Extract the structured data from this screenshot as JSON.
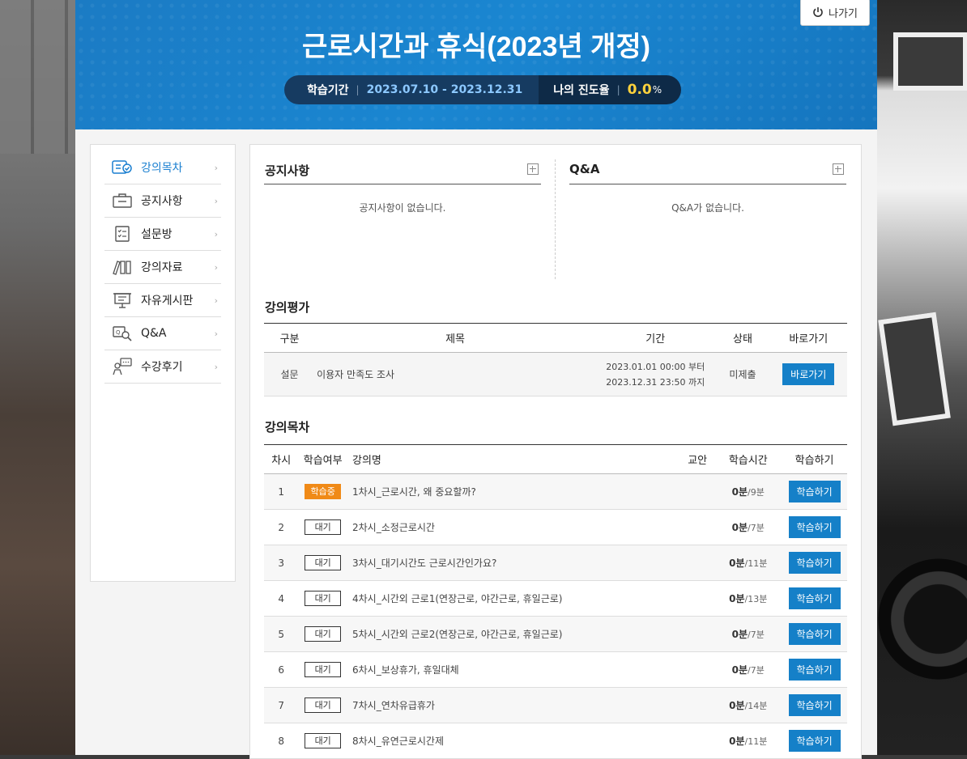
{
  "header": {
    "title": "근로시간과 휴식(2023년 개정)",
    "exit_label": "나가기",
    "period_label": "학습기간",
    "period_value": "2023.07.10 - 2023.12.31",
    "progress_label": "나의 진도율",
    "progress_value": "0.0",
    "progress_unit": "%"
  },
  "sidebar": {
    "items": [
      {
        "label": "강의목차",
        "icon": "list-check-icon"
      },
      {
        "label": "공지사항",
        "icon": "notice-board-icon"
      },
      {
        "label": "설문방",
        "icon": "survey-checklist-icon"
      },
      {
        "label": "강의자료",
        "icon": "books-icon"
      },
      {
        "label": "자유게시판",
        "icon": "presentation-board-icon"
      },
      {
        "label": "Q&A",
        "icon": "qa-search-icon"
      },
      {
        "label": "수강후기",
        "icon": "review-person-icon"
      }
    ]
  },
  "notice": {
    "title": "공지사항",
    "empty": "공지사항이 없습니다."
  },
  "qna": {
    "title": "Q&A",
    "empty": "Q&A가 없습니다."
  },
  "evaluation": {
    "title": "강의평가",
    "headers": [
      "구분",
      "제목",
      "기간",
      "상태",
      "바로가기"
    ],
    "rows": [
      {
        "type": "설문",
        "name": "이용자 만족도 조사",
        "start": "2023.01.01 00:00 부터",
        "end": "2023.12.31 23:50 까지",
        "status": "미제출",
        "action": "바로가기"
      }
    ]
  },
  "lectures": {
    "title": "강의목차",
    "headers": [
      "차시",
      "학습여부",
      "강의명",
      "교안",
      "학습시간",
      "학습하기"
    ],
    "rows": [
      {
        "no": "1",
        "state": "학습중",
        "name": "1차시_근로시간, 왜 중요할까?",
        "done": "0분",
        "total": "/9분",
        "action": "학습하기"
      },
      {
        "no": "2",
        "state": "대기",
        "name": "2차시_소정근로시간",
        "done": "0분",
        "total": "/7분",
        "action": "학습하기"
      },
      {
        "no": "3",
        "state": "대기",
        "name": "3차시_대기시간도 근로시간인가요?",
        "done": "0분",
        "total": "/11분",
        "action": "학습하기"
      },
      {
        "no": "4",
        "state": "대기",
        "name": "4차시_시간외 근로1(연장근로, 야간근로, 휴일근로)",
        "done": "0분",
        "total": "/13분",
        "action": "학습하기"
      },
      {
        "no": "5",
        "state": "대기",
        "name": "5차시_시간외 근로2(연장근로, 야간근로, 휴일근로)",
        "done": "0분",
        "total": "/7분",
        "action": "학습하기"
      },
      {
        "no": "6",
        "state": "대기",
        "name": "6차시_보상휴가, 휴일대체",
        "done": "0분",
        "total": "/7분",
        "action": "학습하기"
      },
      {
        "no": "7",
        "state": "대기",
        "name": "7차시_연차유급휴가",
        "done": "0분",
        "total": "/14분",
        "action": "학습하기"
      },
      {
        "no": "8",
        "state": "대기",
        "name": "8차시_유연근로시간제",
        "done": "0분",
        "total": "/11분",
        "action": "학습하기"
      }
    ]
  },
  "colors": {
    "accent": "#1580c8",
    "header_blue": "#1a86d1",
    "in_progress": "#f08a17",
    "progress_yellow": "#ffd23c"
  }
}
